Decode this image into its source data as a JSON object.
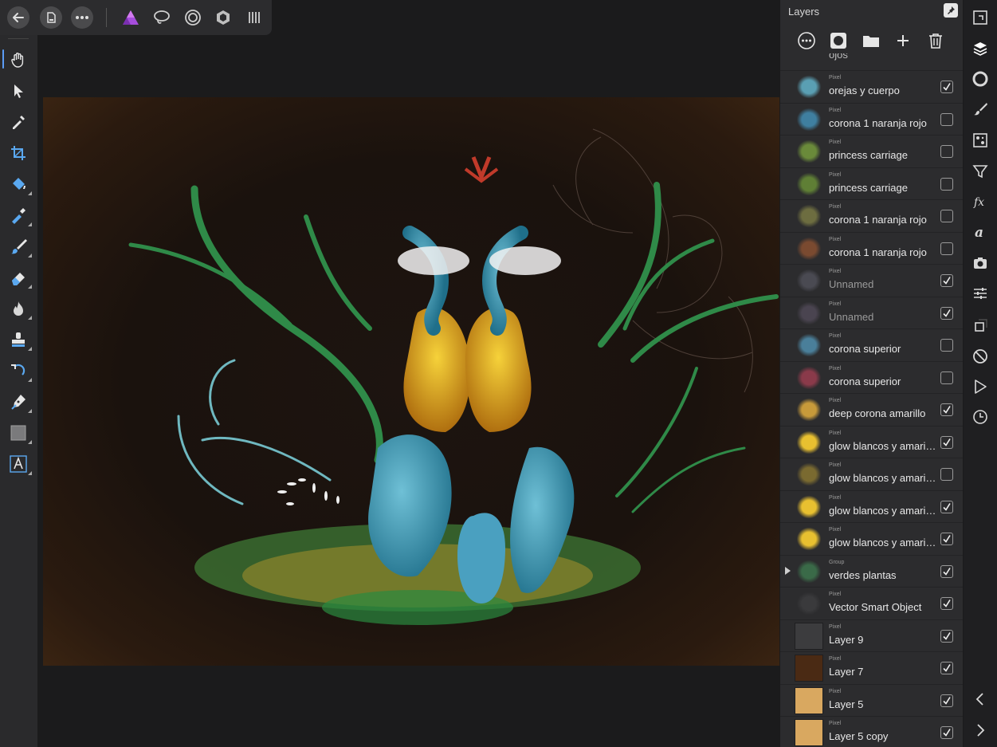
{
  "top_bar": {
    "icons": [
      "back-icon",
      "document-icon",
      "more-icon",
      "affinity-photo-persona-icon",
      "liquify-persona-icon",
      "develop-persona-icon",
      "tone-mapping-persona-icon",
      "export-persona-icon"
    ]
  },
  "tools": [
    "hand-tool",
    "move-tool",
    "color-picker-tool",
    "crop-tool",
    "flood-fill-tool",
    "selection-brush-tool",
    "paint-brush-tool",
    "erase-brush-tool",
    "burn-brush-tool",
    "clone-brush-tool",
    "undo-brush-tool",
    "pen-tool",
    "rectangle-tool",
    "artistic-text-tool"
  ],
  "layers_panel": {
    "title": "Layers",
    "partial_row_label": "ojos",
    "layers": [
      {
        "type": "Pixel",
        "name": "orejas y cuerpo",
        "checked": true,
        "thumb": "#5a9fb3",
        "dim": false
      },
      {
        "type": "Pixel",
        "name": "corona 1 naranja rojo",
        "checked": false,
        "thumb": "#3f7fa0",
        "dim": false
      },
      {
        "type": "Pixel",
        "name": "princess carriage",
        "checked": false,
        "thumb": "#6a8a3a",
        "dim": false
      },
      {
        "type": "Pixel",
        "name": "princess carriage",
        "checked": false,
        "thumb": "#5f7f35",
        "dim": false
      },
      {
        "type": "Pixel",
        "name": "corona 1 naranja rojo",
        "checked": false,
        "thumb": "#6d6d40",
        "dim": false
      },
      {
        "type": "Pixel",
        "name": "corona 1 naranja rojo",
        "checked": false,
        "thumb": "#7a4a30",
        "dim": false
      },
      {
        "type": "Pixel",
        "name": "Unnamed",
        "checked": true,
        "thumb": "#4a4a52",
        "dim": true
      },
      {
        "type": "Pixel",
        "name": "Unnamed",
        "checked": true,
        "thumb": "#4a4450",
        "dim": true
      },
      {
        "type": "Pixel",
        "name": "corona superior",
        "checked": false,
        "thumb": "#4a7f9a",
        "dim": false
      },
      {
        "type": "Pixel",
        "name": "corona superior",
        "checked": false,
        "thumb": "#8a3a4a",
        "dim": false
      },
      {
        "type": "Pixel",
        "name": "deep corona amarillo",
        "checked": true,
        "thumb": "#c79a3a",
        "dim": false
      },
      {
        "type": "Pixel",
        "name": "glow blancos y amarillos",
        "checked": true,
        "thumb": "#e8c030",
        "dim": false
      },
      {
        "type": "Pixel",
        "name": "glow blancos y amarillos",
        "checked": false,
        "thumb": "#7a6a30",
        "dim": false
      },
      {
        "type": "Pixel",
        "name": "glow blancos y amarillos",
        "checked": true,
        "thumb": "#e8c030",
        "dim": false
      },
      {
        "type": "Pixel",
        "name": "glow blancos y amarillos",
        "checked": true,
        "thumb": "#e8c030",
        "dim": false
      },
      {
        "type": "Group",
        "name": "verdes plantas",
        "checked": true,
        "thumb": "#3a6a48",
        "dim": false,
        "group": true
      },
      {
        "type": "Pixel",
        "name": "Vector Smart Object",
        "checked": true,
        "thumb": "#3a3a3c",
        "dim": false
      },
      {
        "type": "Pixel",
        "name": "Layer 9",
        "checked": true,
        "thumb": "#3c3c3e",
        "dim": false,
        "square": true
      },
      {
        "type": "Pixel",
        "name": "Layer 7",
        "checked": true,
        "thumb": "#4a2a14",
        "dim": false,
        "square": true
      },
      {
        "type": "Pixel",
        "name": "Layer 5",
        "checked": true,
        "thumb": "#d9a860",
        "dim": false,
        "square": true
      },
      {
        "type": "Pixel",
        "name": "Layer 5 copy",
        "checked": true,
        "thumb": "#d9a860",
        "dim": false,
        "square": true
      }
    ]
  },
  "right_bar": {
    "icons": [
      "navigator-icon",
      "layers-icon",
      "color-icon",
      "brushes-icon",
      "swatches-icon",
      "filters-icon",
      "fx-icon",
      "text-styles-icon",
      "snapshots-icon",
      "adjustments-icon",
      "transform-icon",
      "no-entry-icon",
      "play-macro-icon",
      "history-icon",
      "collapse-left-icon",
      "expand-right-icon"
    ]
  },
  "colors": {
    "accent": "#5b9cf6",
    "panel_bg": "#2c2c2e",
    "app_bg": "#1b1b1c"
  }
}
